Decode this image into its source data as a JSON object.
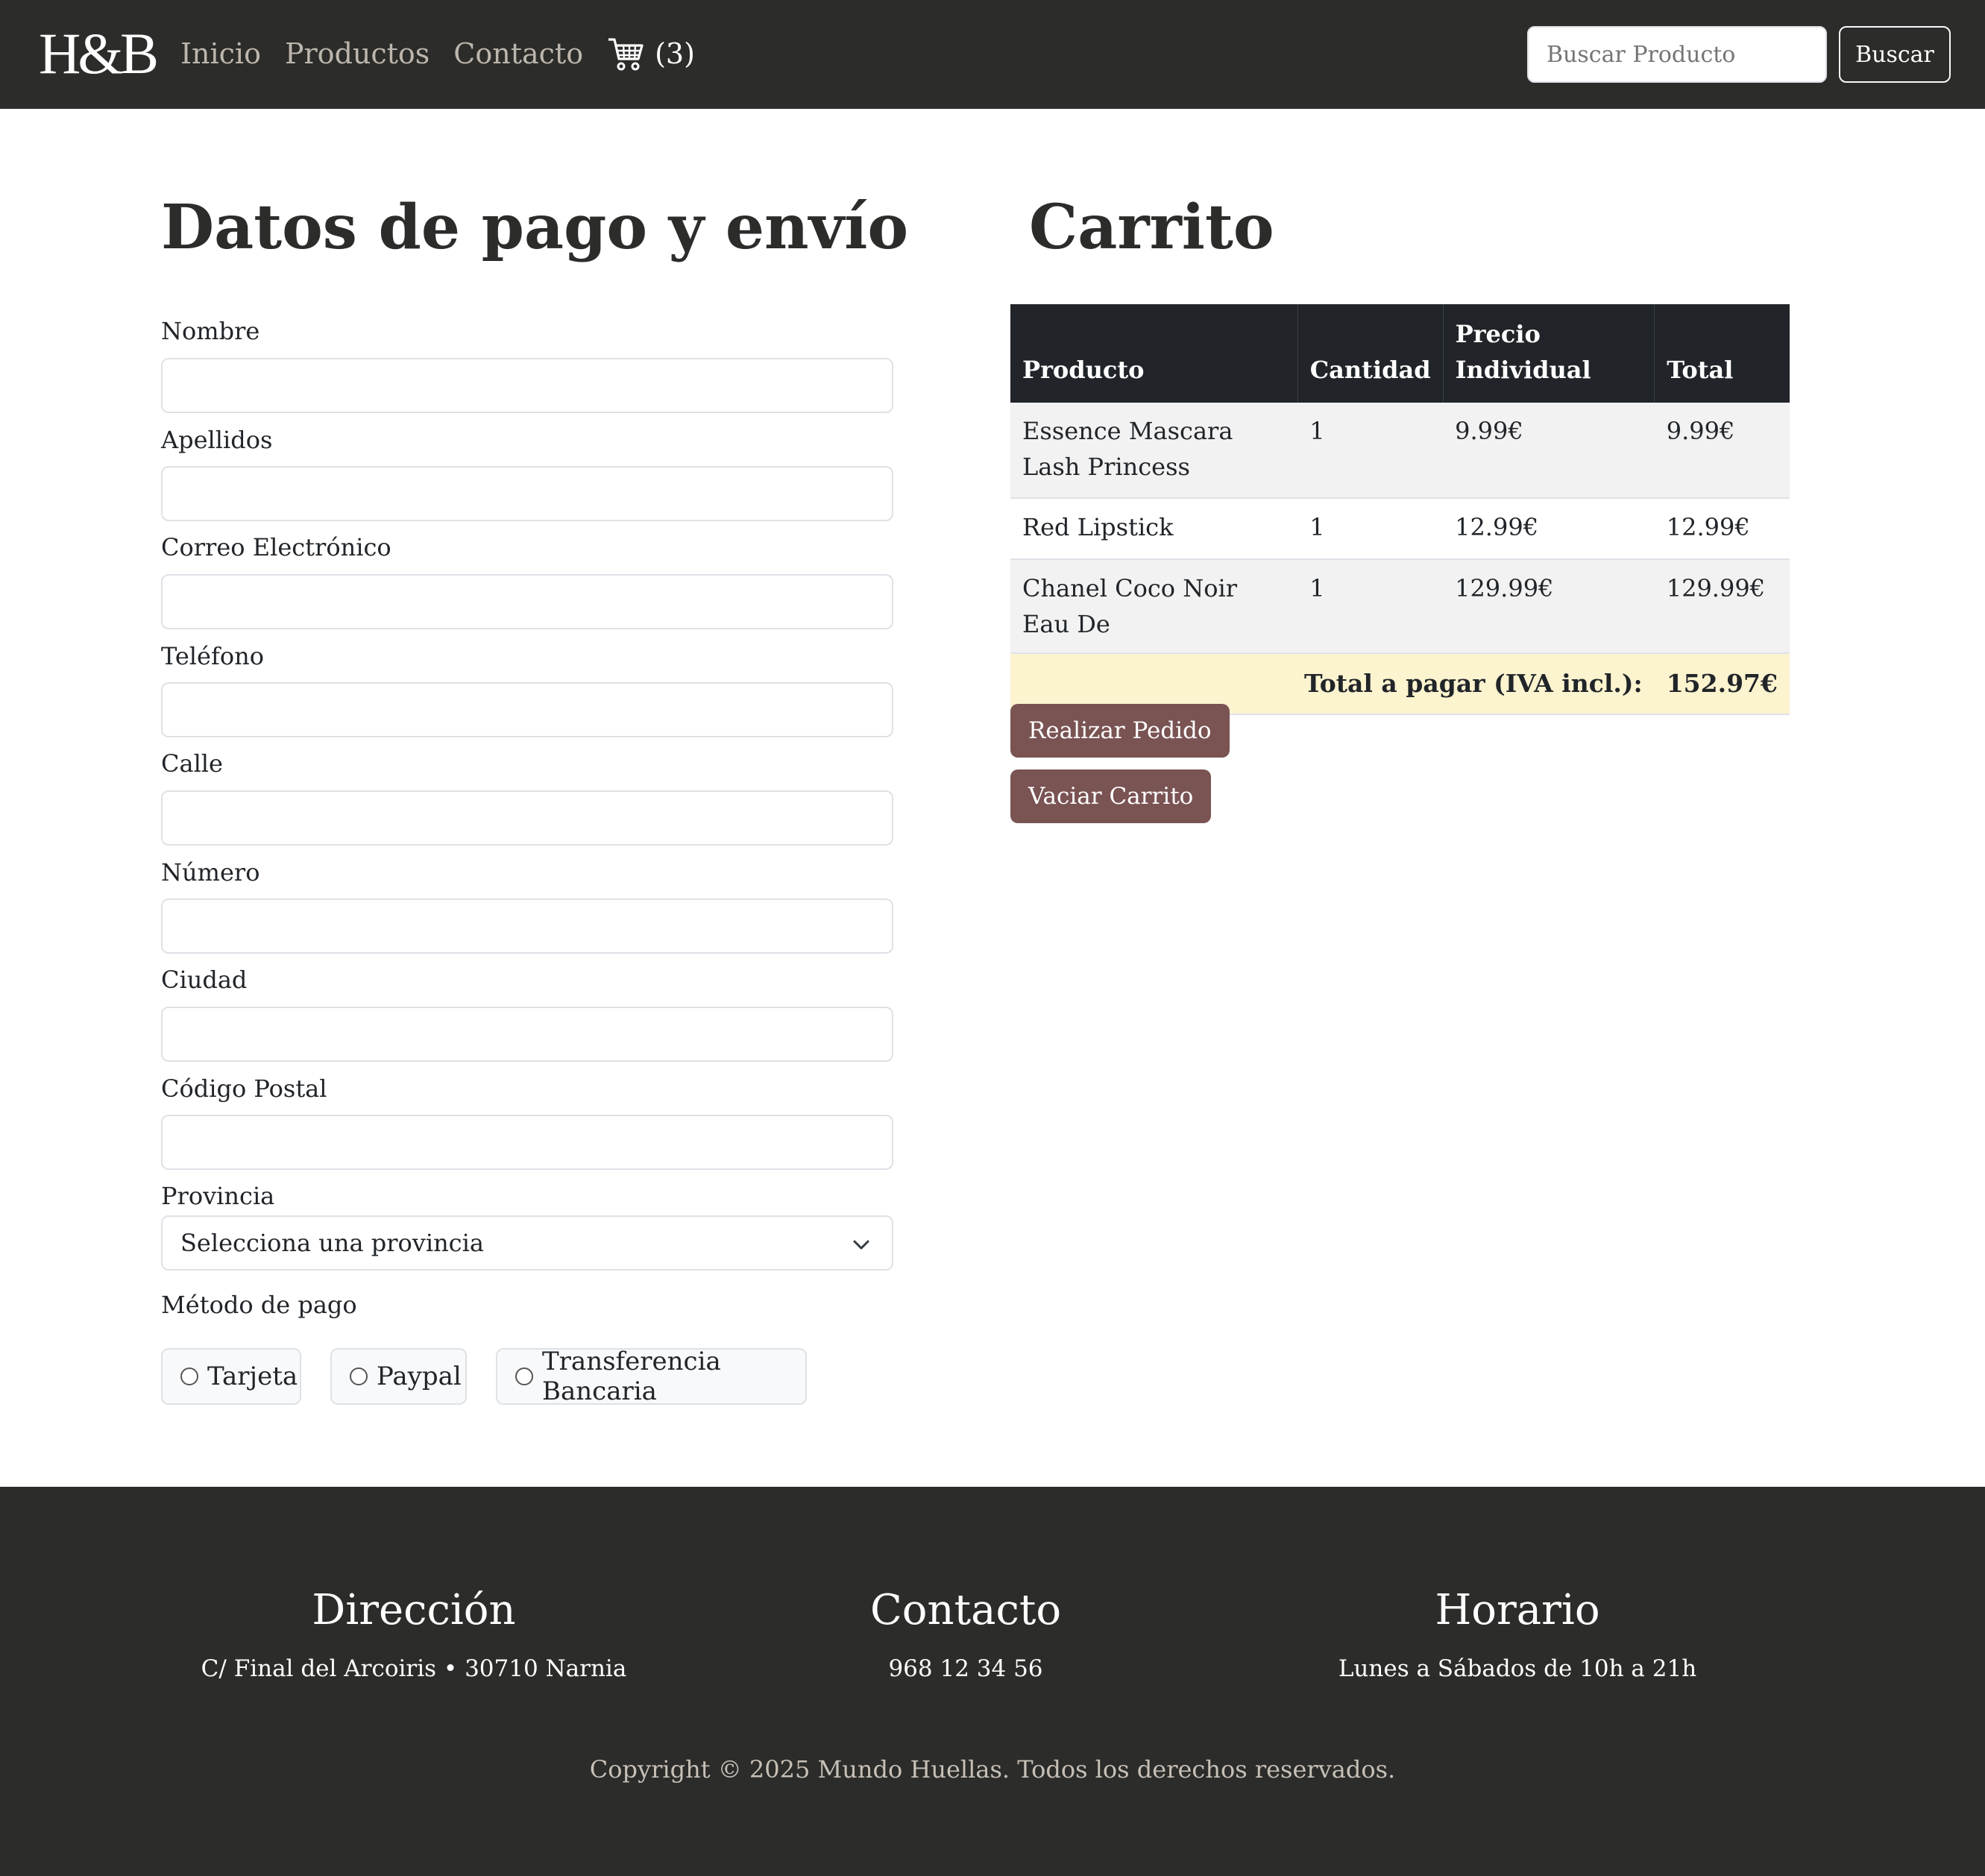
{
  "navbar": {
    "brand": "H&B",
    "links": [
      "Inicio",
      "Productos",
      "Contacto"
    ],
    "cart_count": "(3)",
    "search_placeholder": "Buscar Producto",
    "search_button": "Buscar"
  },
  "form": {
    "title": "Datos de pago y envío",
    "fields": [
      "Nombre",
      "Apellidos",
      "Correo Electrónico",
      "Teléfono",
      "Calle",
      "Número",
      "Ciudad",
      "Código Postal"
    ],
    "province_label": "Provincia",
    "province_selected": "Selecciona una provincia",
    "payment_label": "Método de pago",
    "payment_options": [
      "Tarjeta",
      "Paypal",
      "Transferencia Bancaria"
    ]
  },
  "cart": {
    "title": "Carrito",
    "headers": [
      "Producto",
      "Cantidad",
      "Precio Individual",
      "Total"
    ],
    "rows": [
      {
        "product": "Essence Mascara Lash Princess",
        "qty": "1",
        "price": "9.99€",
        "total": "9.99€"
      },
      {
        "product": "Red Lipstick",
        "qty": "1",
        "price": "12.99€",
        "total": "12.99€"
      },
      {
        "product": "Chanel Coco Noir Eau De",
        "qty": "1",
        "price": "129.99€",
        "total": "129.99€"
      }
    ],
    "total_label": "Total a pagar (IVA incl.):",
    "total_value": "152.97€",
    "order_button": "Realizar Pedido",
    "empty_button": "Vaciar Carrito"
  },
  "footer": {
    "columns": [
      {
        "title": "Dirección",
        "text": "C/ Final del Arcoiris • 30710 Narnia"
      },
      {
        "title": "Contacto",
        "text": "968 12 34 56"
      },
      {
        "title": "Horario",
        "text": "Lunes a Sábados de 10h a 21h"
      }
    ],
    "copyright": "Copyright © 2025 Mundo Huellas. Todos los derechos reservados."
  },
  "icons": {
    "cart": "shopping-cart-icon",
    "chevron": "chevron-down-icon"
  }
}
